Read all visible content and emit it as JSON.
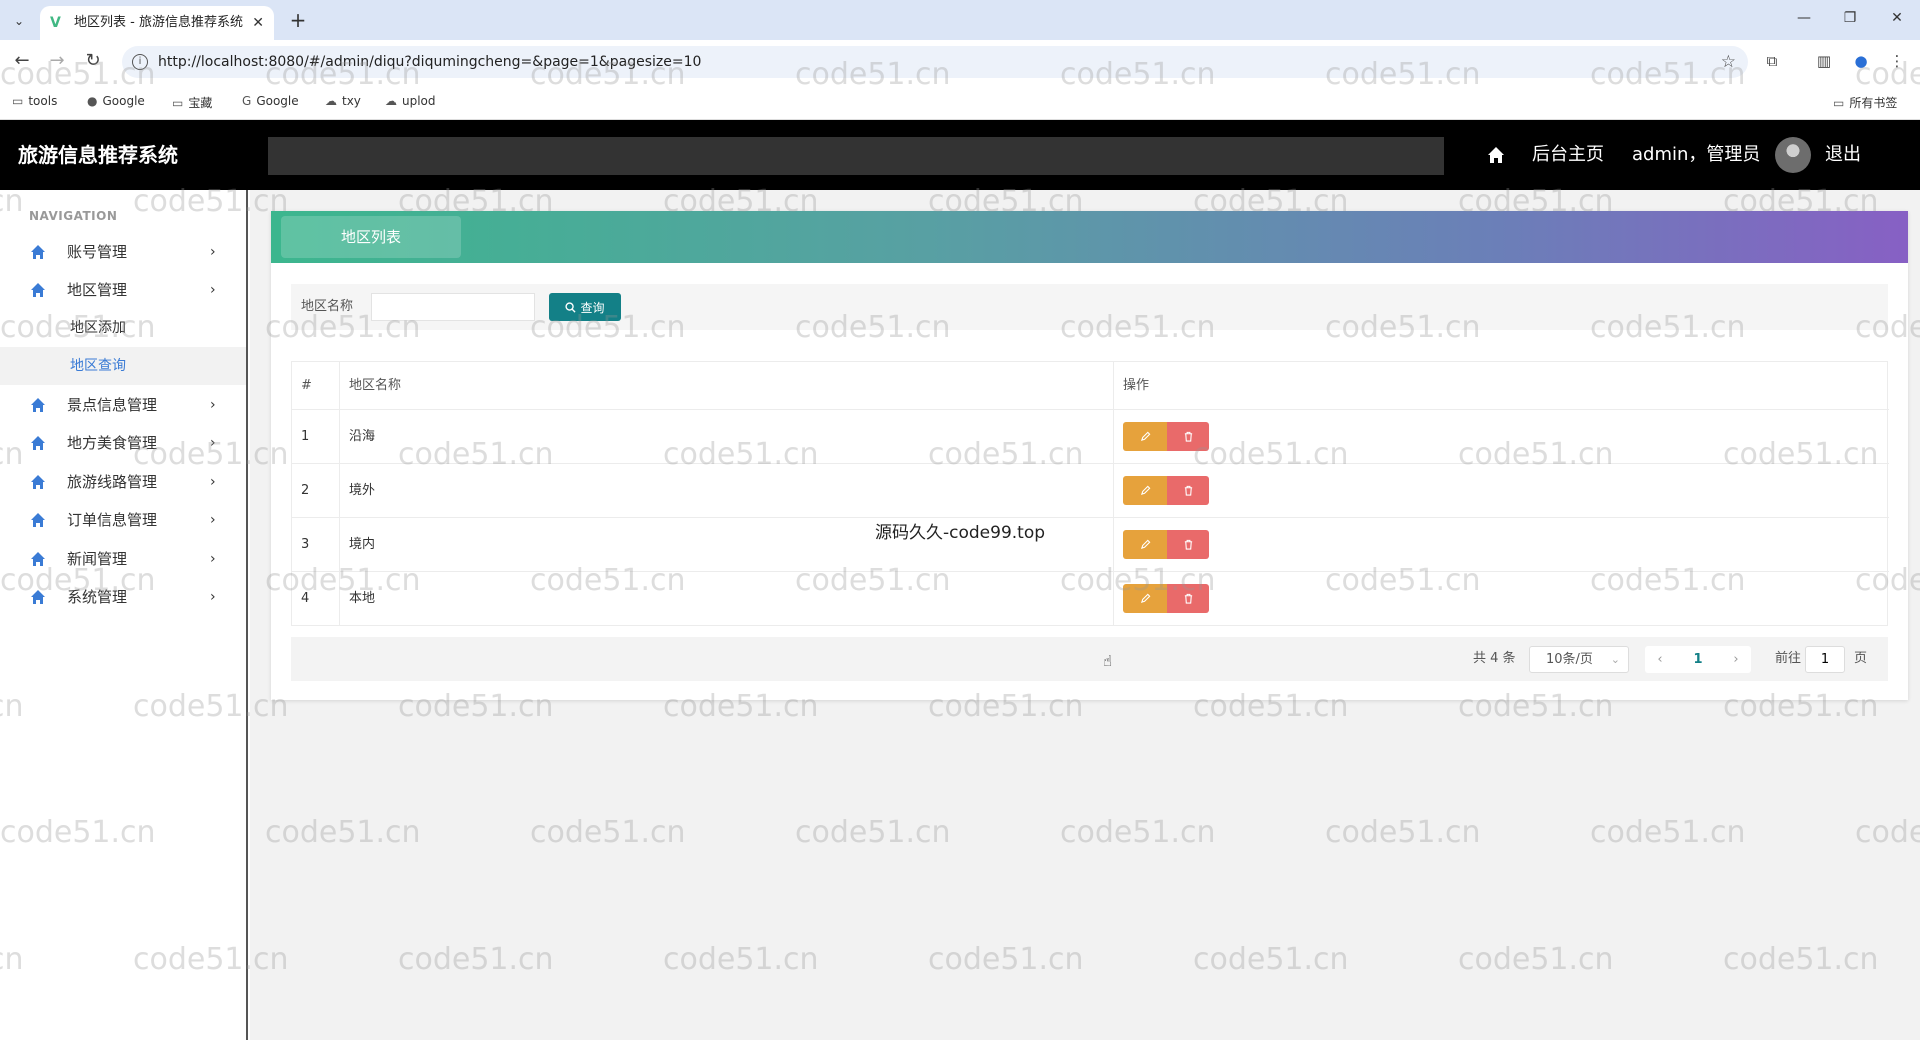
{
  "browser": {
    "tab_title": "地区列表 - 旅游信息推荐系统",
    "url": "http://localhost:8080/#/admin/diqu?diqumingcheng=&page=1&pagesize=10",
    "bookmarks": [
      "tools",
      "Google",
      "宝藏",
      "Google",
      "txy",
      "uplod"
    ],
    "all_bookmarks": "所有书签"
  },
  "header": {
    "app_title": "旅游信息推荐系统",
    "home_link": "后台主页",
    "user": "admin，管理员",
    "logout": "退出"
  },
  "sidebar": {
    "caption": "NAVIGATION",
    "items": [
      {
        "label": "账号管理"
      },
      {
        "label": "地区管理"
      },
      {
        "label": "地区添加"
      },
      {
        "label": "地区查询"
      },
      {
        "label": "景点信息管理"
      },
      {
        "label": "地方美食管理"
      },
      {
        "label": "旅游线路管理"
      },
      {
        "label": "订单信息管理"
      },
      {
        "label": "新闻管理"
      },
      {
        "label": "系统管理"
      }
    ]
  },
  "panel": {
    "title": "地区列表",
    "search_label": "地区名称",
    "search_value": "",
    "search_button": "查询"
  },
  "table": {
    "columns": [
      "#",
      "地区名称",
      "操作"
    ],
    "rows": [
      {
        "num": "1",
        "name": "沿海"
      },
      {
        "num": "2",
        "name": "境外"
      },
      {
        "num": "3",
        "name": "境内"
      },
      {
        "num": "4",
        "name": "本地"
      }
    ]
  },
  "pagination": {
    "total": "共 4 条",
    "page_size": "10条/页",
    "current_page": "1",
    "goto_label": "前往",
    "goto_value": "1",
    "page_suffix": "页"
  },
  "overlay_text": "源码久久-code99.top",
  "watermark": "code51.cn",
  "colors": {
    "header_bg": "#000000",
    "primary": "#138087",
    "edit_button": "#e6a23c",
    "delete_button": "#e96a6a",
    "gradient_start": "#3cb68e",
    "gradient_end": "#8760c4"
  }
}
